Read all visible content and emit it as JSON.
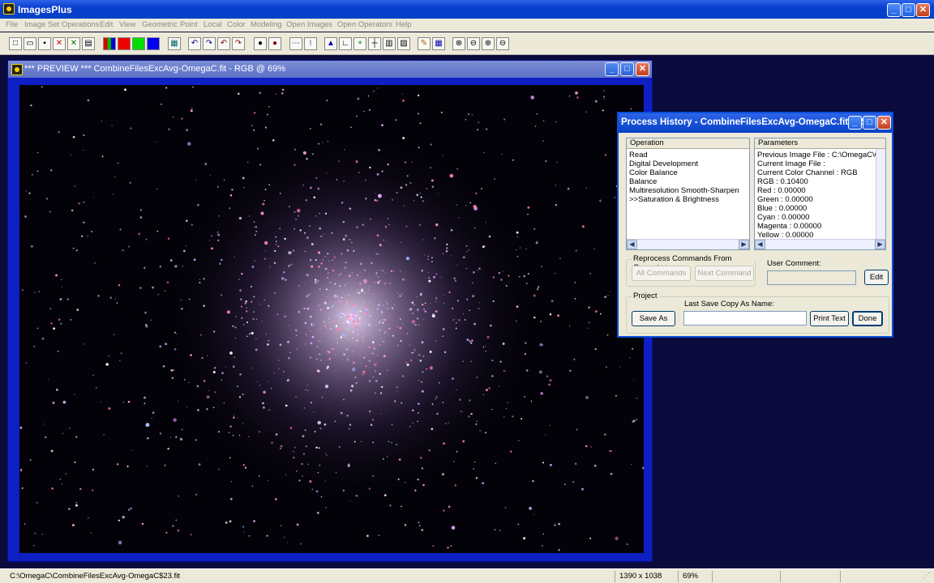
{
  "app": {
    "title": "ImagesPlus"
  },
  "menu": [
    "File",
    "Image Set Operations",
    "Edit",
    "View",
    "Geometric",
    "Point",
    "Local",
    "Color",
    "Modeling",
    "Open Images",
    "Open Operators",
    "Help"
  ],
  "preview": {
    "title": "*** PREVIEW *** CombineFilesExcAvg-OmegaC.fit - RGB @ 69%"
  },
  "history": {
    "title": "Process History - CombineFilesExcAvg-OmegaC.fit - R...",
    "operation_header": "Operation",
    "operations": [
      "Read",
      "Digital Development",
      "Color Balance",
      "Balance",
      "Multiresolution Smooth-Sharpen",
      ">>Saturation & Brightness"
    ],
    "parameters_header": "Parameters",
    "parameters": [
      "Previous Image File : C:\\OmegaC\\Com",
      "Current Image File :",
      "Current Color Channel : RGB",
      "RGB : 0.10400",
      "Red : 0.00000",
      "Green : 0.00000",
      "Blue : 0.00000",
      "Cyan : 0.00000",
      "Magenta : 0.00000",
      "Yellow : 0.00000"
    ],
    "reprocess_label": "Reprocess Commands From Current >>",
    "all_commands": "All Commands",
    "next_command": "Next Command",
    "user_comment_label": "User Comment:",
    "edit": "Edit",
    "project_label": "Project",
    "last_save_label": "Last Save Copy As Name:",
    "save_as": "Save As",
    "print_text": "Print Text",
    "done": "Done"
  },
  "status": {
    "path": "C:\\OmegaC\\CombineFilesExcAvg-OmegaC$23.fit",
    "dimensions": "1390 x 1038",
    "zoom": "69%"
  },
  "colors": {
    "titlebar": "#0a3ed0",
    "workspace": "#0a0a3c",
    "preview_border": "#0e1fc4"
  }
}
